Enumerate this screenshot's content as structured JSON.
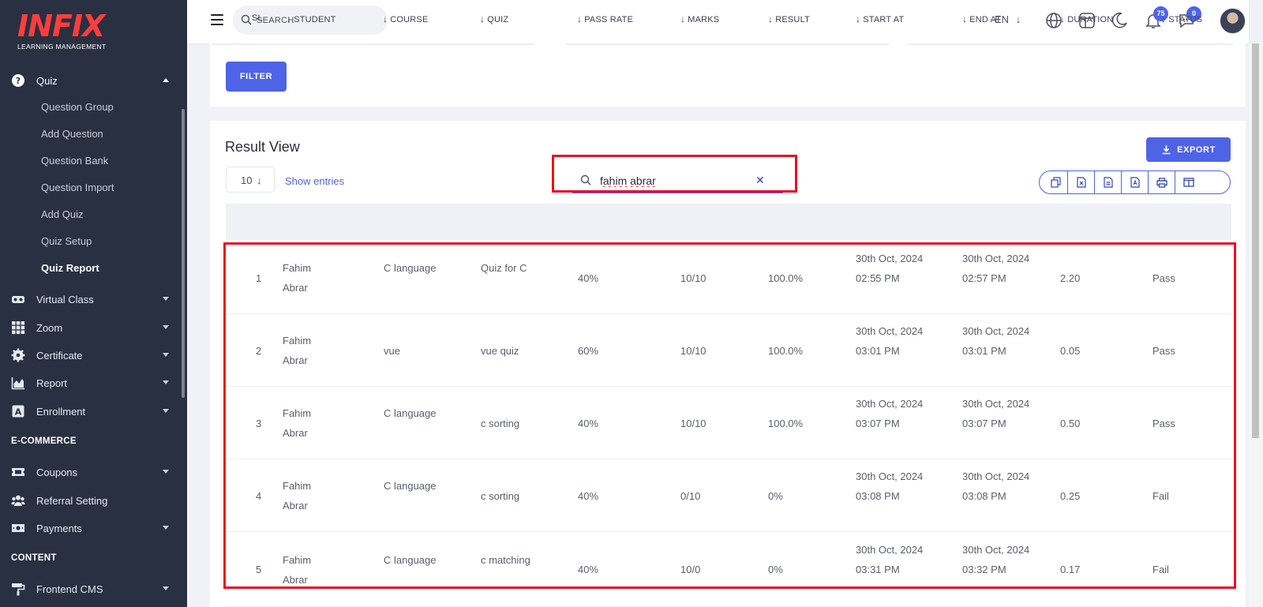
{
  "brand": {
    "logo_text": "INFIX",
    "subtitle": "LEARNING MANAGEMENT"
  },
  "sidebar": {
    "quiz": {
      "label": "Quiz",
      "icon": "question-circle-icon"
    },
    "quiz_children": [
      {
        "label": "Question Group"
      },
      {
        "label": "Add Question"
      },
      {
        "label": "Question Bank"
      },
      {
        "label": "Question Import"
      },
      {
        "label": "Add Quiz"
      },
      {
        "label": "Quiz Setup"
      },
      {
        "label": "Quiz Report",
        "active": true
      }
    ],
    "menu": [
      {
        "label": "Virtual Class",
        "icon": "vr-headset-icon"
      },
      {
        "label": "Zoom",
        "icon": "grid-icon"
      },
      {
        "label": "Certificate",
        "icon": "gear-badge-icon"
      },
      {
        "label": "Report",
        "icon": "area-chart-icon"
      },
      {
        "label": "Enrollment",
        "icon": "letter-a-icon"
      }
    ],
    "ecommerce_heading": "E-COMMERCE",
    "ecommerce": [
      {
        "label": "Coupons",
        "icon": "ticket-icon",
        "has_caret": true
      },
      {
        "label": "Referral Setting",
        "icon": "users-icon",
        "has_caret": false
      },
      {
        "label": "Payments",
        "icon": "money-icon",
        "has_caret": true
      }
    ],
    "content_heading": "CONTENT",
    "content": [
      {
        "label": "Frontend CMS",
        "icon": "paint-roller-icon"
      }
    ]
  },
  "header": {
    "search_placeholder": "SEARCH",
    "language": "EN",
    "notifications_count": "75",
    "messages_count": "0"
  },
  "filter": {
    "button": "FILTER"
  },
  "results": {
    "title": "Result View",
    "export_label": "EXPORT",
    "entries_value": "10",
    "show_entries": "Show entries",
    "search_value": "fahim abrar",
    "columns": [
      "SL",
      "STUDENT",
      "COURSE",
      "QUIZ",
      "PASS RATE",
      "MARKS",
      "RESULT",
      "START AT",
      "END AT",
      "DURATION",
      "STATUS"
    ],
    "rows": [
      {
        "sl": "1",
        "student": "Fahim Abrar",
        "course": "C language",
        "quiz": "Quiz for C",
        "pass_rate": "40%",
        "marks": "10/10",
        "result": "100.0%",
        "start_at": "30th Oct, 2024 02:55 PM",
        "end_at": "30th Oct, 2024 02:57 PM",
        "duration": "2.20",
        "status": "Pass"
      },
      {
        "sl": "2",
        "student": "Fahim Abrar",
        "course": "vue",
        "quiz": "vue quiz",
        "pass_rate": "60%",
        "marks": "10/10",
        "result": "100.0%",
        "start_at": "30th Oct, 2024 03:01 PM",
        "end_at": "30th Oct, 2024 03:01 PM",
        "duration": "0.05",
        "status": "Pass"
      },
      {
        "sl": "3",
        "student": "Fahim Abrar",
        "course": "C language",
        "quiz": "c sorting",
        "pass_rate": "40%",
        "marks": "10/10",
        "result": "100.0%",
        "start_at": "30th Oct, 2024 03:07 PM",
        "end_at": "30th Oct, 2024 03:07 PM",
        "duration": "0.50",
        "status": "Pass"
      },
      {
        "sl": "4",
        "student": "Fahim Abrar",
        "course": "C language",
        "quiz": "c sorting",
        "pass_rate": "40%",
        "marks": "0/10",
        "result": "0%",
        "start_at": "30th Oct, 2024 03:08 PM",
        "end_at": "30th Oct, 2024 03:08 PM",
        "duration": "0.25",
        "status": "Fail"
      },
      {
        "sl": "5",
        "student": "Fahim Abrar",
        "course": "C language",
        "quiz": "c matching",
        "pass_rate": "40%",
        "marks": "10/0",
        "result": "0%",
        "start_at": "30th Oct, 2024 03:31 PM",
        "end_at": "30th Oct, 2024 03:32 PM",
        "duration": "0.17",
        "status": "Fail"
      }
    ]
  },
  "colors": {
    "sidebar": "#293042",
    "accent": "#4f63e7",
    "highlight": "#e8121f",
    "logo": "#ff3d3d"
  }
}
